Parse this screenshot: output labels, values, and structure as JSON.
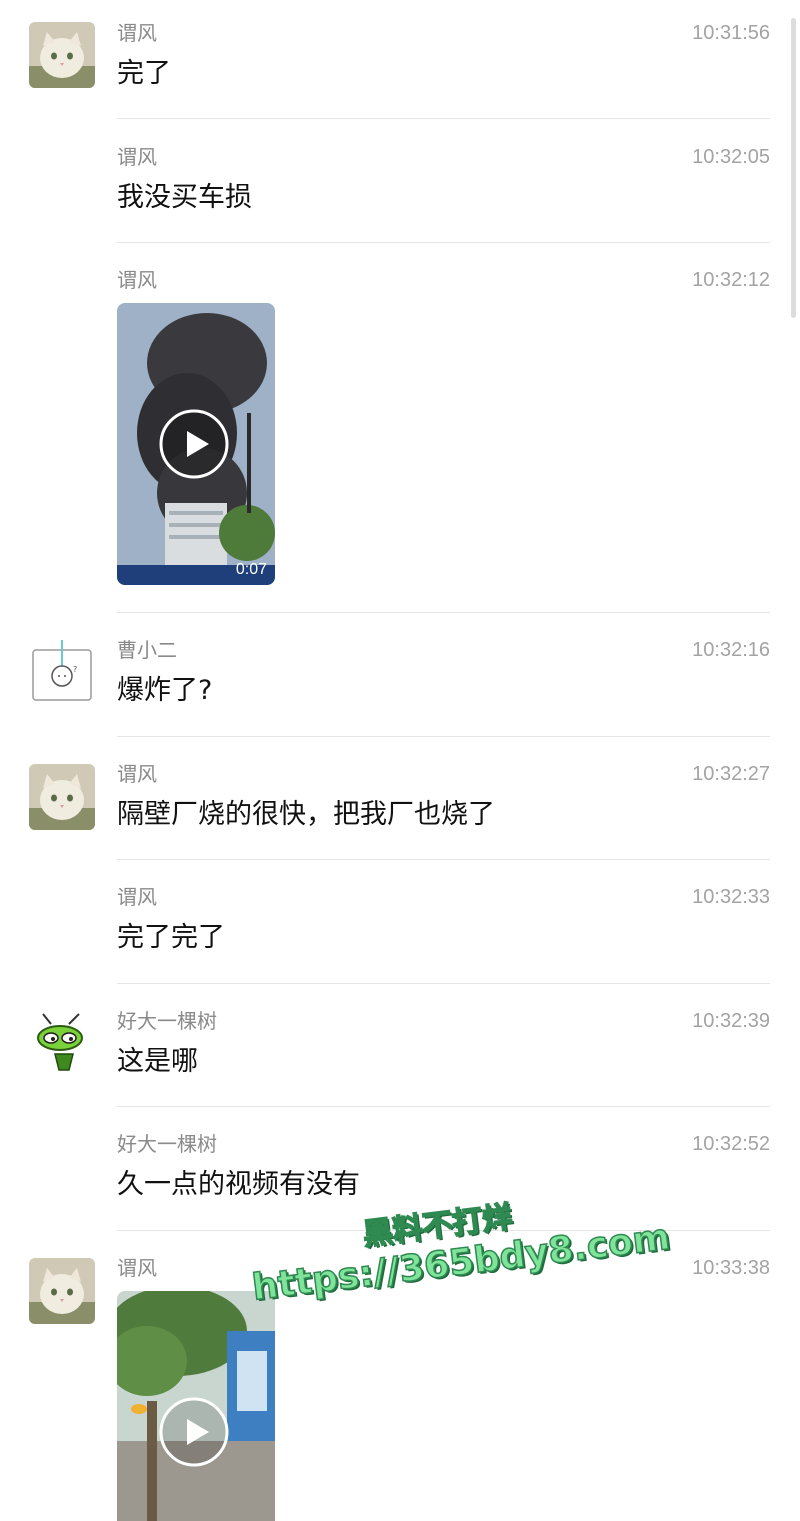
{
  "messages": [
    {
      "sender": "谓风",
      "time": "10:31:56",
      "text": "完了"
    },
    {
      "sender": "谓风",
      "time": "10:32:05",
      "text": "我没买车损"
    },
    {
      "sender": "谓风",
      "time": "10:32:12",
      "video_duration": "0:07"
    },
    {
      "sender": "曹小二",
      "time": "10:32:16",
      "text": "爆炸了?"
    },
    {
      "sender": "谓风",
      "time": "10:32:27",
      "text": "隔壁厂烧的很快，把我厂也烧了"
    },
    {
      "sender": "谓风",
      "time": "10:32:33",
      "text": "完了完了"
    },
    {
      "sender": "好大一棵树",
      "time": "10:32:39",
      "text": "这是哪"
    },
    {
      "sender": "好大一棵树",
      "time": "10:32:52",
      "text": "久一点的视频有没有"
    },
    {
      "sender": "谓风",
      "time": "10:33:38"
    }
  ],
  "watermark": {
    "line1": "黑料不打烊",
    "line2": "https://365bdy8.com"
  },
  "colors": {
    "sender": "#8a8a8a",
    "time": "#a3a3a3",
    "text": "#111111",
    "watermark": "#7fe39a"
  },
  "icons": {
    "avatar_weifeng": "cat-avatar-icon",
    "avatar_caoxiaoer": "doodle-avatar-icon",
    "avatar_tree": "green-bug-avatar-icon",
    "play": "play-icon"
  }
}
